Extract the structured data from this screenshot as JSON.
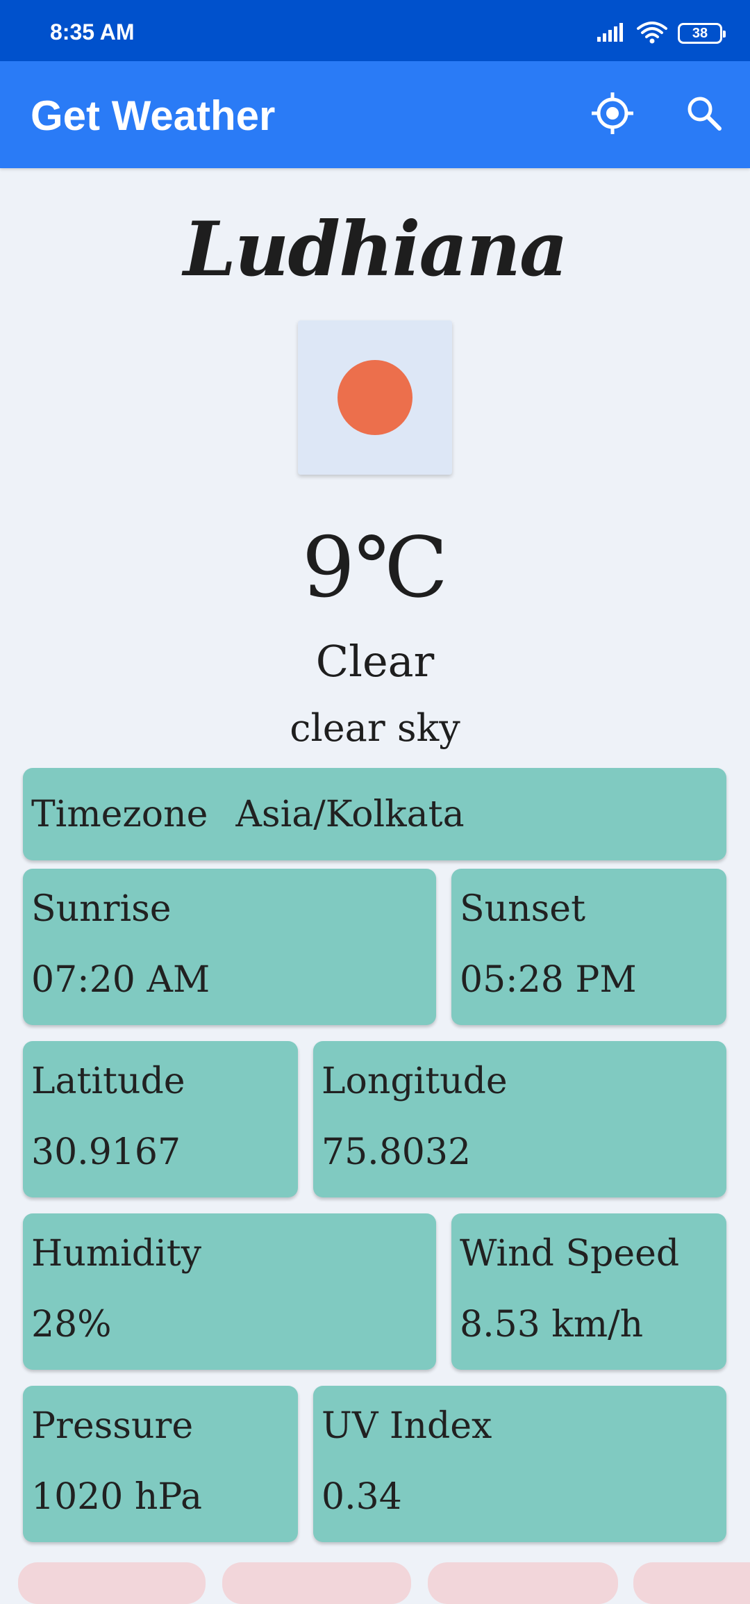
{
  "status_bar": {
    "time": "8:35 AM",
    "battery": "38",
    "icons": [
      "signal-icon",
      "wifi-icon",
      "battery-icon"
    ]
  },
  "app_bar": {
    "title": "Get Weather",
    "actions": [
      "location-icon",
      "search-icon"
    ],
    "color": "#2a7bf6"
  },
  "weather": {
    "city": "Ludhiana",
    "icon": "clear-sun-icon",
    "temperature": "9℃",
    "main": "Clear",
    "description": "clear sky"
  },
  "details": {
    "timezone": {
      "label": "Timezone",
      "value": "Asia/Kolkata"
    },
    "sunrise": {
      "label": "Sunrise",
      "value": "07:20 AM"
    },
    "sunset": {
      "label": "Sunset",
      "value": "05:28 PM"
    },
    "latitude": {
      "label": "Latitude",
      "value": "30.9167"
    },
    "longitude": {
      "label": "Longitude",
      "value": "75.8032"
    },
    "humidity": {
      "label": "Humidity",
      "value": "28%"
    },
    "wind_speed": {
      "label": "Wind Speed",
      "value": "8.53 km/h"
    },
    "pressure": {
      "label": "Pressure",
      "value": "1020 hPa"
    },
    "uv_index": {
      "label": "UV Index",
      "value": "0.34"
    }
  },
  "colors": {
    "status_bar": "#0051cc",
    "card": "#80cac1",
    "sun": "#ec6f4c",
    "background": "#eef2f8"
  }
}
